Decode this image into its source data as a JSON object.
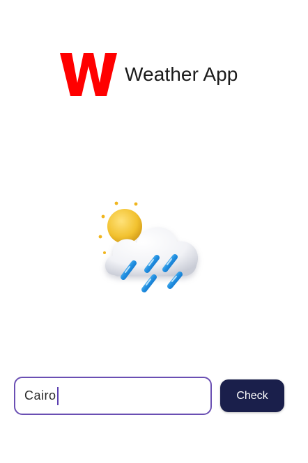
{
  "header": {
    "logo_icon": "w-logo-icon",
    "title": "Weather App",
    "brand_color": "#ff0000"
  },
  "illustration": {
    "icon": "sun-cloud-rain-icon"
  },
  "search": {
    "value": "Cairo",
    "accent_color": "#6a4fb3"
  },
  "actions": {
    "check_label": "Check",
    "button_color": "#1a1f4b"
  }
}
